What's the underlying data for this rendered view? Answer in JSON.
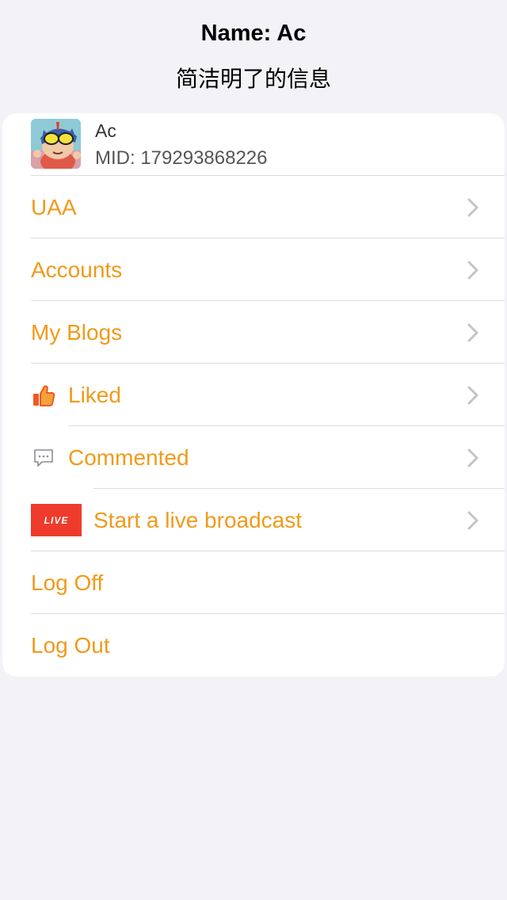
{
  "header": {
    "title": "Name: Ac",
    "subtitle": "简洁明了的信息"
  },
  "profile": {
    "name": "Ac",
    "mid": "MID: 179293868226",
    "avatar_icon": "cartoon-avatar"
  },
  "menu": [
    {
      "label": "UAA",
      "icon": null,
      "chevron": true
    },
    {
      "label": "Accounts",
      "icon": null,
      "chevron": true
    },
    {
      "label": "My Blogs",
      "icon": null,
      "chevron": true
    },
    {
      "label": "Liked",
      "icon": "thumbs-up-icon",
      "chevron": true
    },
    {
      "label": "Commented",
      "icon": "comment-icon",
      "chevron": true
    },
    {
      "label": "Start a live broadcast",
      "icon": "live-icon",
      "icon_text": "LIVE",
      "chevron": true
    },
    {
      "label": "Log Off",
      "icon": null,
      "chevron": false
    },
    {
      "label": "Log Out",
      "icon": null,
      "chevron": false
    }
  ],
  "colors": {
    "accent": "#f09a1a",
    "background": "#f2f2f7",
    "card": "#ffffff",
    "live_red": "#ee3b2b",
    "thumb_orange": "#f05a22"
  }
}
